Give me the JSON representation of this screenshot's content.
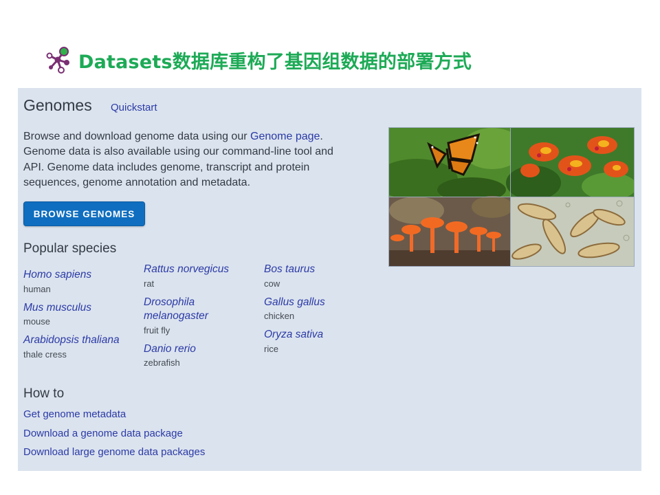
{
  "slide": {
    "title": "Datasets数据库重构了基因组数据的部署方式",
    "title_color": "#1daa56"
  },
  "genomes": {
    "heading": "Genomes",
    "quickstart_link": "Quickstart",
    "intro_before": "Browse and download genome data using our ",
    "intro_link": "Genome page",
    "intro_after": ". Genome data is also available using our command-line tool and API. Genome data includes genome, transcript and protein sequences, genome annotation and metadata.",
    "browse_button": "BROWSE GENOMES"
  },
  "popular": {
    "heading": "Popular species",
    "columns": [
      [
        {
          "scientific": "Homo sapiens",
          "common": "human"
        },
        {
          "scientific": "Mus musculus",
          "common": "mouse"
        },
        {
          "scientific": "Arabidopsis thaliana",
          "common": "thale cress"
        }
      ],
      [
        {
          "scientific": "Rattus norvegicus",
          "common": "rat"
        },
        {
          "scientific": "Drosophila melanogaster",
          "common": "fruit fly"
        },
        {
          "scientific": "Danio rerio",
          "common": "zebrafish"
        }
      ],
      [
        {
          "scientific": "Bos taurus",
          "common": "cow"
        },
        {
          "scientific": "Gallus gallus",
          "common": "chicken"
        },
        {
          "scientific": "Oryza sativa",
          "common": "rice"
        }
      ]
    ]
  },
  "howto": {
    "heading": "How to",
    "links": [
      "Get genome metadata",
      "Download a genome data package",
      "Download large genome data packages"
    ]
  },
  "photos": {
    "tiles": [
      "butterfly-photo",
      "flower-photo",
      "mushroom-photo",
      "microbe-photo"
    ]
  },
  "colors": {
    "panel_background": "#dbe3ee",
    "link": "#2b3aa6",
    "button": "#0f6ebf",
    "text": "#333a44"
  }
}
